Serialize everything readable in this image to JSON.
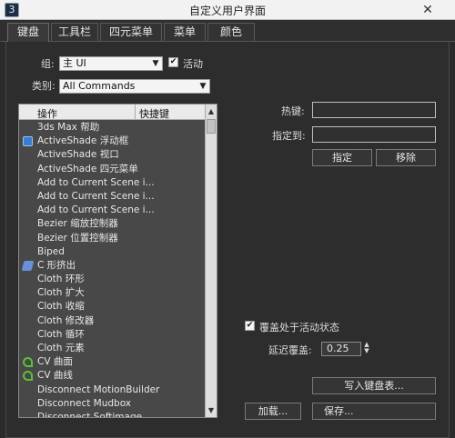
{
  "window": {
    "title": "自定义用户界面",
    "app_icon": "3",
    "close_glyph": "✕"
  },
  "tabs": [
    {
      "label": "键盘"
    },
    {
      "label": "工具栏"
    },
    {
      "label": "四元菜单"
    },
    {
      "label": "菜单"
    },
    {
      "label": "颜色"
    }
  ],
  "group": {
    "label": "组:",
    "value": "主 UI"
  },
  "active_checkbox": {
    "label": "活动",
    "checked": true
  },
  "category": {
    "label": "类别:",
    "value": "All Commands"
  },
  "list": {
    "col_action": "操作",
    "col_shortcut": "快捷键",
    "rows": [
      {
        "text": "3ds Max 帮助",
        "icon": ""
      },
      {
        "text": "ActiveShade 浮动框",
        "icon": "activeshade-icon"
      },
      {
        "text": "ActiveShade 视口",
        "icon": ""
      },
      {
        "text": "ActiveShade 四元菜单",
        "icon": ""
      },
      {
        "text": "Add to Current Scene i...",
        "icon": ""
      },
      {
        "text": "Add to Current Scene i...",
        "icon": ""
      },
      {
        "text": "Add to Current Scene i...",
        "icon": ""
      },
      {
        "text": "Bezier 缩放控制器",
        "icon": ""
      },
      {
        "text": "Bezier 位置控制器",
        "icon": ""
      },
      {
        "text": "Biped",
        "icon": ""
      },
      {
        "text": "C 形挤出",
        "icon": "c-extrude-icon"
      },
      {
        "text": "Cloth 环形",
        "icon": ""
      },
      {
        "text": "Cloth 扩大",
        "icon": ""
      },
      {
        "text": "Cloth 收缩",
        "icon": ""
      },
      {
        "text": "Cloth 修改器",
        "icon": ""
      },
      {
        "text": "Cloth 循环",
        "icon": ""
      },
      {
        "text": "Cloth 元素",
        "icon": ""
      },
      {
        "text": "CV 曲面",
        "icon": "cv-surface-icon"
      },
      {
        "text": "CV 曲线",
        "icon": "cv-curve-icon"
      },
      {
        "text": "Disconnect MotionBuilder",
        "icon": ""
      },
      {
        "text": "Disconnect Mudbox",
        "icon": ""
      },
      {
        "text": "Disconnect Softimage",
        "icon": ""
      }
    ]
  },
  "hotkey": {
    "label": "热键:",
    "value": ""
  },
  "assigned_to": {
    "label": "指定到:",
    "value": ""
  },
  "buttons": {
    "assign": "指定",
    "remove": "移除",
    "write_keyboard_chart": "写入键盘表...",
    "load": "加载...",
    "save": "保存..."
  },
  "override": {
    "label": "覆盖处于活动状态",
    "checked": true
  },
  "delay": {
    "label": "延迟覆盖:",
    "value": "0.25"
  }
}
